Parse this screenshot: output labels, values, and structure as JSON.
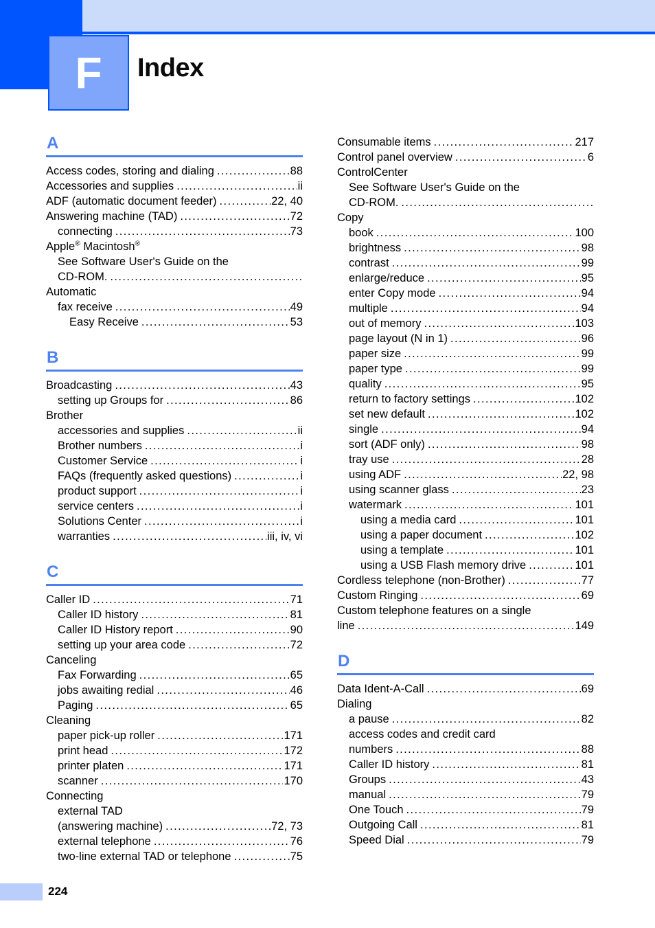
{
  "header": {
    "chapter_letter": "F",
    "title": "Index"
  },
  "footer": {
    "page_number": "224"
  },
  "colors": {
    "header_dark": "#0055ff",
    "header_band": "#cbdbfa",
    "tab_fill": "#7fa6fb",
    "section_accent": "#4d82ee",
    "footer_bar": "#b9cefb"
  },
  "columns": {
    "left": [
      {
        "letter": "A",
        "entries": [
          {
            "text": "Access codes, storing and dialing",
            "page": "88",
            "indent": 0,
            "leader": true
          },
          {
            "text": "Accessories and supplies",
            "page": "ii",
            "indent": 0,
            "leader": true
          },
          {
            "text": "ADF (automatic document feeder)",
            "page": "22, 40",
            "indent": 0,
            "leader": true
          },
          {
            "text": "Answering machine (TAD)",
            "page": "72",
            "indent": 0,
            "leader": true
          },
          {
            "text": "connecting",
            "page": "73",
            "indent": 1,
            "leader": true
          },
          {
            "html": "Apple<sup>®</sup> Macintosh<sup>®</sup>",
            "text": "Apple® Macintosh®",
            "page": "",
            "indent": 0,
            "leader": false
          },
          {
            "text": "See Software User's Guide on the",
            "page": "",
            "indent": 1,
            "leader": false
          },
          {
            "text": "CD-ROM.",
            "page": "",
            "indent": 1,
            "leader": true
          },
          {
            "text": "Automatic",
            "page": "",
            "indent": 0,
            "leader": false
          },
          {
            "text": "fax receive",
            "page": "49",
            "indent": 1,
            "leader": true
          },
          {
            "text": "Easy Receive",
            "page": "53",
            "indent": 2,
            "leader": true
          }
        ]
      },
      {
        "letter": "B",
        "entries": [
          {
            "text": "Broadcasting",
            "page": "43",
            "indent": 0,
            "leader": true
          },
          {
            "text": "setting up Groups for",
            "page": "86",
            "indent": 1,
            "leader": true
          },
          {
            "text": "Brother",
            "page": "",
            "indent": 0,
            "leader": false
          },
          {
            "text": "accessories and supplies",
            "page": "ii",
            "indent": 1,
            "leader": true
          },
          {
            "text": "Brother numbers",
            "page": "i",
            "indent": 1,
            "leader": true
          },
          {
            "text": "Customer Service",
            "page": "i",
            "indent": 1,
            "leader": true
          },
          {
            "text": "FAQs (frequently asked questions)",
            "page": "i",
            "indent": 1,
            "leader": true
          },
          {
            "text": "product support",
            "page": "i",
            "indent": 1,
            "leader": true
          },
          {
            "text": "service centers",
            "page": "i",
            "indent": 1,
            "leader": true
          },
          {
            "text": "Solutions Center",
            "page": "i",
            "indent": 1,
            "leader": true
          },
          {
            "text": "warranties",
            "page": "iii, iv, vi",
            "indent": 1,
            "leader": true
          }
        ]
      },
      {
        "letter": "C",
        "entries": [
          {
            "text": "Caller ID",
            "page": "71",
            "indent": 0,
            "leader": true
          },
          {
            "text": "Caller ID history",
            "page": "81",
            "indent": 1,
            "leader": true
          },
          {
            "text": "Caller ID History report",
            "page": "90",
            "indent": 1,
            "leader": true
          },
          {
            "text": "setting up your area code",
            "page": "72",
            "indent": 1,
            "leader": true
          },
          {
            "text": "Canceling",
            "page": "",
            "indent": 0,
            "leader": false
          },
          {
            "text": "Fax Forwarding",
            "page": "65",
            "indent": 1,
            "leader": true
          },
          {
            "text": "jobs awaiting redial",
            "page": "46",
            "indent": 1,
            "leader": true
          },
          {
            "text": "Paging",
            "page": "65",
            "indent": 1,
            "leader": true
          },
          {
            "text": "Cleaning",
            "page": "",
            "indent": 0,
            "leader": false
          },
          {
            "text": "paper pick-up roller",
            "page": "171",
            "indent": 1,
            "leader": true
          },
          {
            "text": "print head",
            "page": "172",
            "indent": 1,
            "leader": true
          },
          {
            "text": "printer platen",
            "page": "171",
            "indent": 1,
            "leader": true
          },
          {
            "text": "scanner",
            "page": "170",
            "indent": 1,
            "leader": true
          },
          {
            "text": "Connecting",
            "page": "",
            "indent": 0,
            "leader": false
          },
          {
            "text": "external TAD",
            "page": "",
            "indent": 1,
            "leader": false
          },
          {
            "text": "(answering machine)",
            "page": "72, 73",
            "indent": 1,
            "leader": true
          },
          {
            "text": "external telephone",
            "page": "76",
            "indent": 1,
            "leader": true
          },
          {
            "text": "two-line external TAD or telephone",
            "page": "75",
            "indent": 1,
            "leader": true
          }
        ]
      }
    ],
    "right": [
      {
        "letter": "",
        "entries": [
          {
            "text": "Consumable items",
            "page": "217",
            "indent": 0,
            "leader": true
          },
          {
            "text": "Control panel overview",
            "page": "6",
            "indent": 0,
            "leader": true
          },
          {
            "text": "ControlCenter",
            "page": "",
            "indent": 0,
            "leader": false
          },
          {
            "text": "See Software User's Guide on the",
            "page": "",
            "indent": 1,
            "leader": false
          },
          {
            "text": "CD-ROM.",
            "page": "",
            "indent": 1,
            "leader": true
          },
          {
            "text": "Copy",
            "page": "",
            "indent": 0,
            "leader": false
          },
          {
            "text": "book",
            "page": "100",
            "indent": 1,
            "leader": true
          },
          {
            "text": "brightness",
            "page": "98",
            "indent": 1,
            "leader": true
          },
          {
            "text": "contrast",
            "page": "99",
            "indent": 1,
            "leader": true
          },
          {
            "text": "enlarge/reduce",
            "page": "95",
            "indent": 1,
            "leader": true
          },
          {
            "text": "enter Copy mode",
            "page": "94",
            "indent": 1,
            "leader": true
          },
          {
            "text": "multiple",
            "page": "94",
            "indent": 1,
            "leader": true
          },
          {
            "text": "out of memory",
            "page": "103",
            "indent": 1,
            "leader": true
          },
          {
            "text": "page layout (N in 1)",
            "page": "96",
            "indent": 1,
            "leader": true
          },
          {
            "text": "paper size",
            "page": "99",
            "indent": 1,
            "leader": true
          },
          {
            "text": "paper type",
            "page": "99",
            "indent": 1,
            "leader": true
          },
          {
            "text": "quality",
            "page": "95",
            "indent": 1,
            "leader": true
          },
          {
            "text": "return to factory settings",
            "page": "102",
            "indent": 1,
            "leader": true
          },
          {
            "text": "set new default",
            "page": "102",
            "indent": 1,
            "leader": true
          },
          {
            "text": "single",
            "page": "94",
            "indent": 1,
            "leader": true
          },
          {
            "text": "sort (ADF only)",
            "page": "98",
            "indent": 1,
            "leader": true
          },
          {
            "text": "tray use",
            "page": "28",
            "indent": 1,
            "leader": true
          },
          {
            "text": "using ADF",
            "page": "22, 98",
            "indent": 1,
            "leader": true
          },
          {
            "text": "using scanner glass",
            "page": "23",
            "indent": 1,
            "leader": true
          },
          {
            "text": "watermark",
            "page": "101",
            "indent": 1,
            "leader": true
          },
          {
            "text": "using a media card",
            "page": "101",
            "indent": 2,
            "leader": true
          },
          {
            "text": "using a paper document",
            "page": "102",
            "indent": 2,
            "leader": true
          },
          {
            "text": "using a template",
            "page": "101",
            "indent": 2,
            "leader": true
          },
          {
            "text": "using a USB Flash memory drive",
            "page": "101",
            "indent": 2,
            "leader": true
          },
          {
            "text": "Cordless telephone (non-Brother)",
            "page": "77",
            "indent": 0,
            "leader": true
          },
          {
            "text": "Custom Ringing",
            "page": "69",
            "indent": 0,
            "leader": true
          },
          {
            "text": "Custom telephone features on a single",
            "page": "",
            "indent": 0,
            "leader": false
          },
          {
            "text": "line",
            "page": "149",
            "indent": 0,
            "leader": true
          }
        ]
      },
      {
        "letter": "D",
        "entries": [
          {
            "text": "Data Ident-A-Call",
            "page": "69",
            "indent": 0,
            "leader": true
          },
          {
            "text": "Dialing",
            "page": "",
            "indent": 0,
            "leader": false
          },
          {
            "text": "a pause",
            "page": "82",
            "indent": 1,
            "leader": true
          },
          {
            "text": "access codes and credit card",
            "page": "",
            "indent": 1,
            "leader": false
          },
          {
            "text": "numbers",
            "page": "88",
            "indent": 1,
            "leader": true
          },
          {
            "text": "Caller ID history",
            "page": "81",
            "indent": 1,
            "leader": true
          },
          {
            "text": "Groups",
            "page": "43",
            "indent": 1,
            "leader": true
          },
          {
            "text": "manual",
            "page": "79",
            "indent": 1,
            "leader": true
          },
          {
            "text": "One Touch",
            "page": "79",
            "indent": 1,
            "leader": true
          },
          {
            "text": "Outgoing Call",
            "page": "81",
            "indent": 1,
            "leader": true
          },
          {
            "text": "Speed Dial",
            "page": "79",
            "indent": 1,
            "leader": true
          }
        ]
      }
    ]
  }
}
